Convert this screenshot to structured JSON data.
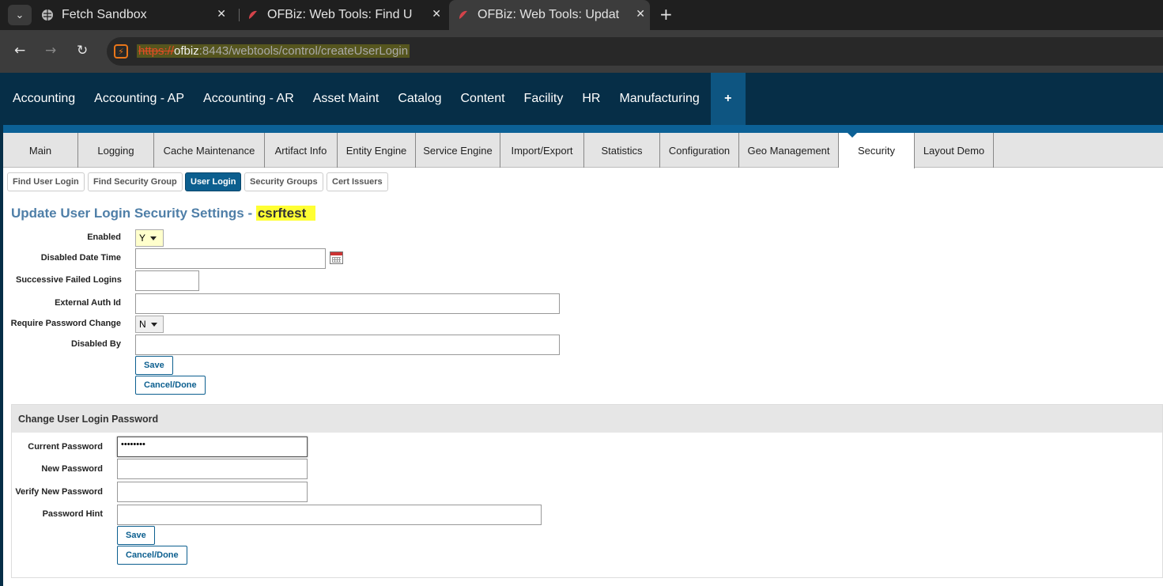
{
  "browser": {
    "tabs": [
      {
        "title": "Fetch Sandbox",
        "icon": "globe-icon"
      },
      {
        "title": "OFBiz: Web Tools: Find U",
        "icon": "ofbiz-icon"
      },
      {
        "title": "OFBiz: Web Tools: Updat",
        "icon": "ofbiz-icon"
      }
    ],
    "url": {
      "scheme": "https://",
      "host": "ofbiz",
      "rest": ":8443/webtools/control/createUserLogin"
    }
  },
  "app_menu": [
    "Accounting",
    "Accounting - AP",
    "Accounting - AR",
    "Asset Maint",
    "Catalog",
    "Content",
    "Facility",
    "HR",
    "Manufacturing",
    "+"
  ],
  "component_tabs": [
    "Main",
    "Logging",
    "Cache Maintenance",
    "Artifact Info",
    "Entity Engine",
    "Service Engine",
    "Import/Export",
    "Statistics",
    "Configuration",
    "Geo Management",
    "Security",
    "Layout Demo"
  ],
  "sub_buttons": [
    "Find User Login",
    "Find Security Group",
    "User Login",
    "Security Groups",
    "Cert Issuers"
  ],
  "page": {
    "title": "Update User Login Security Settings - ",
    "user": "csrftest"
  },
  "security_form": {
    "enabled_label": "Enabled",
    "enabled_value": "Y",
    "disabled_date_label": "Disabled Date Time",
    "failed_logins_label": "Successive Failed Logins",
    "external_auth_label": "External Auth Id",
    "require_pw_label": "Require Password Change",
    "require_pw_value": "N",
    "disabled_by_label": "Disabled By",
    "save": "Save",
    "cancel": "Cancel/Done"
  },
  "password_form": {
    "header": "Change User Login Password",
    "current_label": "Current Password",
    "current_value": "••••••••",
    "new_label": "New Password",
    "verify_label": "Verify New Password",
    "hint_label": "Password Hint",
    "save": "Save",
    "cancel": "Cancel/Done"
  }
}
